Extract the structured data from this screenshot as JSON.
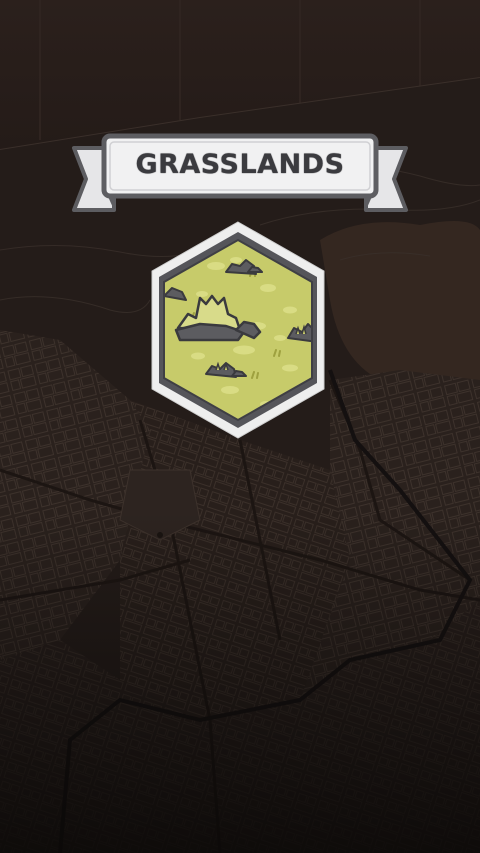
{
  "scene": {
    "biome_title": "GRASSLANDS",
    "badge_icon": "grassland-hex-icon"
  },
  "colors": {
    "background": "#231b18",
    "map_lines": "#3a302b",
    "banner_fill": "#f1f1f2",
    "banner_border": "#5d5d61",
    "title_text": "#3b3b3f",
    "hex_border_outer": "#eeeeee",
    "hex_border_inner": "#55555a",
    "grass_fill": "#c7cb6a",
    "grass_dark": "#9ea13f",
    "rock_fill": "#5c5c60"
  }
}
